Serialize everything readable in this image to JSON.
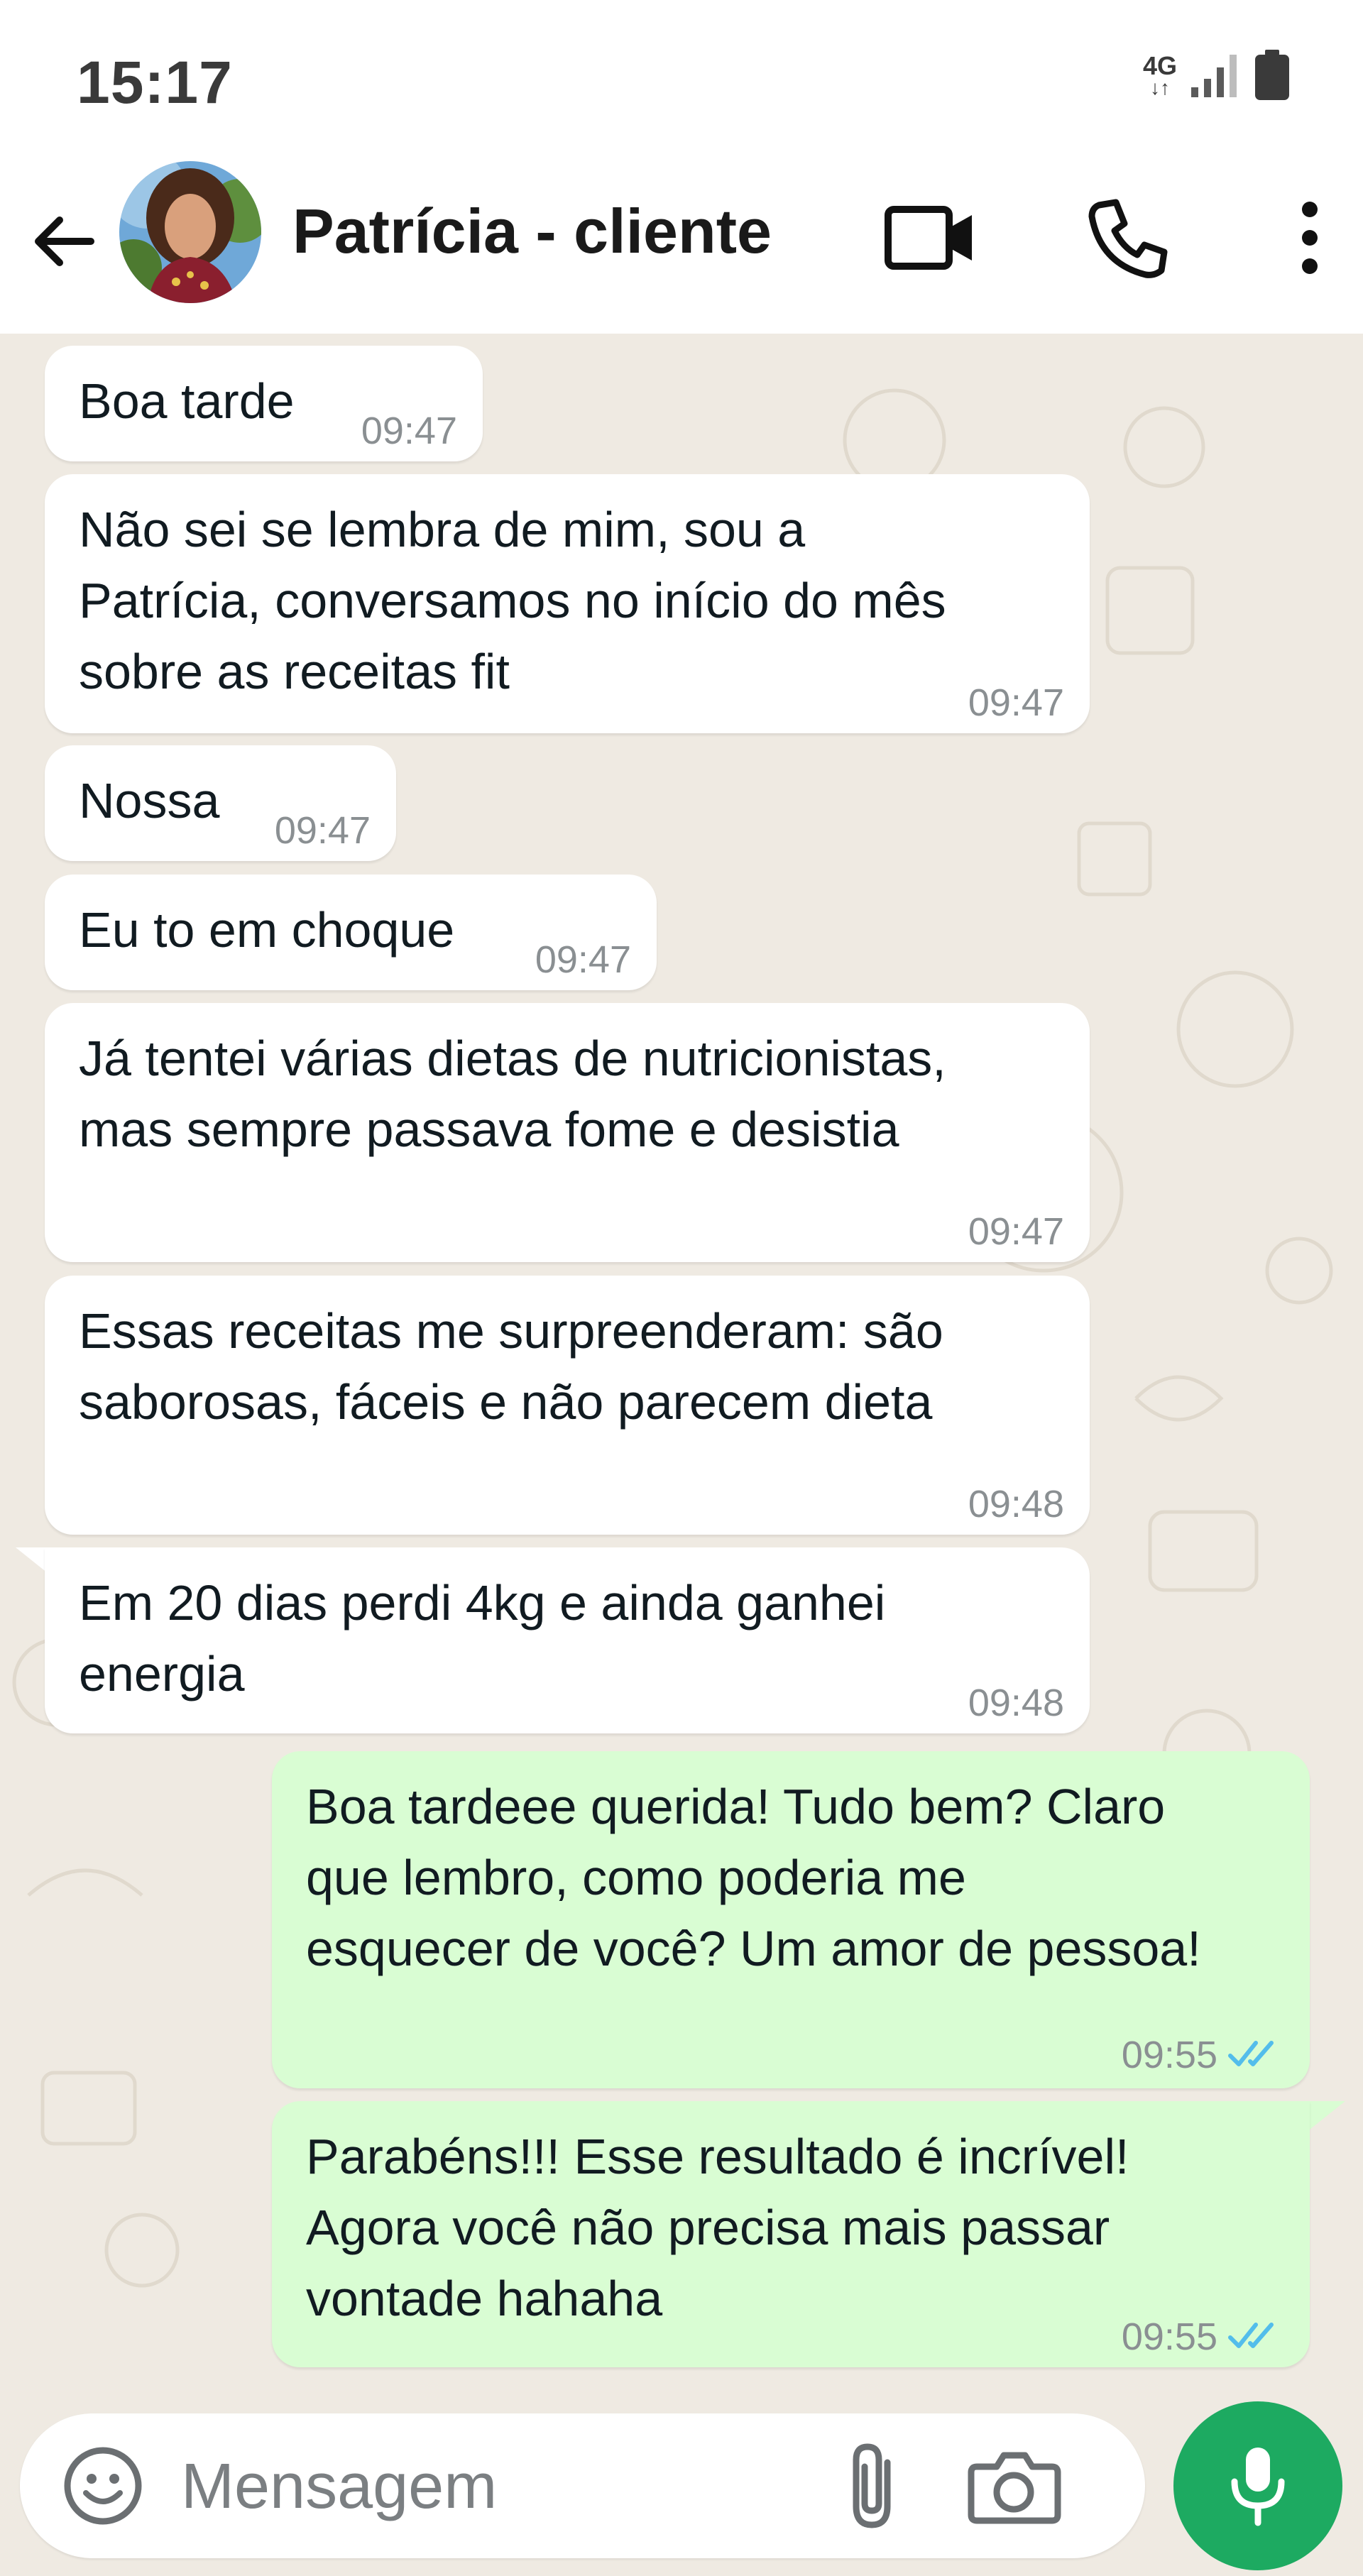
{
  "status_bar": {
    "time": "15:17",
    "network": "4G",
    "network_arrows": "↓↑",
    "signal_icon": "signal-bars-icon",
    "battery_icon": "battery-icon"
  },
  "header": {
    "contact_name": "Patrícia - cliente",
    "back_icon": "arrow-left-icon",
    "video_icon": "video-camera-icon",
    "call_icon": "phone-icon",
    "menu_icon": "more-vertical-icon"
  },
  "messages": [
    {
      "direction": "in",
      "text": "Boa tarde",
      "time": "09:47"
    },
    {
      "direction": "in",
      "text": "Não sei se lembra de mim, sou a\nPatrícia, conversamos no início do mês\nsobre as receitas fit",
      "time": "09:47"
    },
    {
      "direction": "in",
      "text": "Nossa",
      "time": "09:47"
    },
    {
      "direction": "in",
      "text": "Eu to em choque",
      "time": "09:47"
    },
    {
      "direction": "in",
      "text": "Já tentei várias dietas de nutricionistas,\nmas sempre passava fome e desistia",
      "time": "09:47"
    },
    {
      "direction": "in",
      "text": "Essas receitas me surpreenderam: são\nsaborosas, fáceis e não parecem dieta",
      "time": "09:48"
    },
    {
      "direction": "in",
      "text": "Em 20 dias perdi 4kg e ainda ganhei\nenergia",
      "time": "09:48"
    },
    {
      "direction": "out",
      "text": "Boa tardeee querida! Tudo bem? Claro\nque lembro, como poderia me\nesquecer de você? Um amor de pessoa!",
      "time": "09:55",
      "status": "read"
    },
    {
      "direction": "out",
      "text": "Parabéns!!! Esse resultado é incrível!\nAgora você não precisa mais passar\nvontade hahaha",
      "time": "09:55",
      "status": "read"
    }
  ],
  "input": {
    "placeholder": "Mensagem",
    "emoji_icon": "emoji-icon",
    "attach_icon": "paperclip-icon",
    "camera_icon": "camera-icon",
    "mic_icon": "microphone-icon"
  },
  "colors": {
    "chat_background": "#efeae2",
    "incoming_bubble": "#ffffff",
    "outgoing_bubble": "#d9fdd3",
    "read_ticks": "#53bdeb",
    "mic_button": "#1daa61"
  }
}
